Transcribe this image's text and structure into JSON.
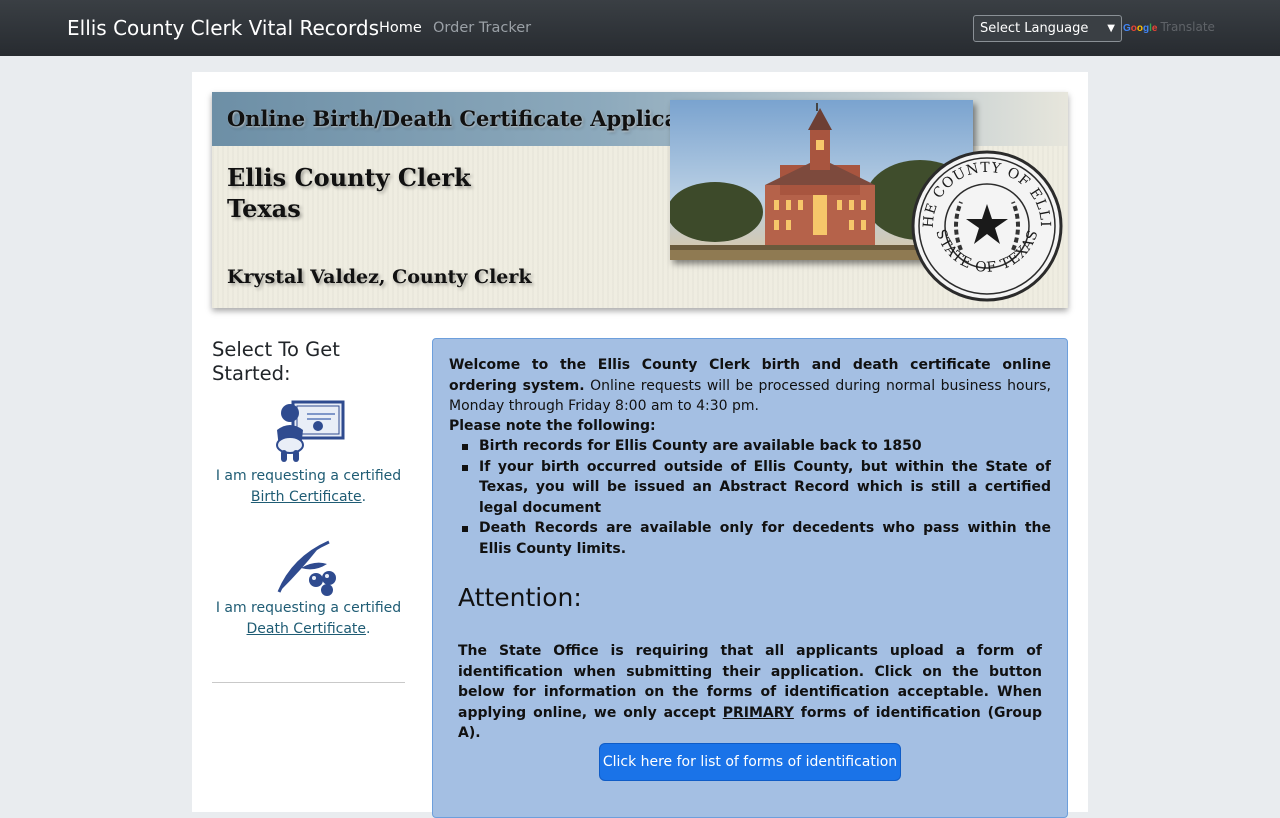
{
  "navbar": {
    "brand": "Ellis County Clerk Vital Records",
    "links": [
      {
        "label": "Home"
      },
      {
        "label": "Order Tracker"
      }
    ],
    "language_select": "Select Language",
    "translate_label": "Translate"
  },
  "banner": {
    "title": "Online Birth/Death Certificate Application",
    "org_line1": "Ellis County Clerk",
    "org_line2": "Texas",
    "clerk": "Krystal Valdez, County Clerk",
    "seal_top": "THE COUNTY OF ELLIS",
    "seal_bottom": "STATE OF TEXAS"
  },
  "sidebar": {
    "heading": "Select To Get Started:",
    "birth": {
      "prefix": "I am requesting a certified",
      "link": "Birth Certificate",
      "suffix": "."
    },
    "death": {
      "prefix": "I am requesting a certified",
      "link": "Death Certificate",
      "suffix": "."
    }
  },
  "info": {
    "welcome_bold": "Welcome to the Ellis County Clerk birth and death certificate online ordering system.",
    "welcome_rest": "Online requests will be processed during normal business hours, Monday through Friday 8:00 am to 4:30 pm.",
    "please_note": "Please note the following:",
    "notes": [
      "Birth records for Ellis County are available back to 1850",
      "If your birth occurred outside of Ellis County, but within the State of Texas, you will be issued an Abstract Record which is still a certified legal document",
      "Death Records are available only for decedents who pass within the Ellis County limits."
    ],
    "attention_heading": "Attention:",
    "attention_part1": "The State Office is requiring that all applicants upload a form of identification when submitting their application. Click on the button below for information on the forms of identification acceptable. When applying online, we only accept",
    "attention_primary": "PRIMARY",
    "attention_part2": "forms of identification (Group A).",
    "button_label": "Click here for list of forms of identification"
  },
  "colors": {
    "navbar": "#272b30",
    "panel_bg": "#a4bfe3",
    "panel_border": "#6d9fdc",
    "button": "#1a73e8",
    "link": "#1f5c74"
  }
}
